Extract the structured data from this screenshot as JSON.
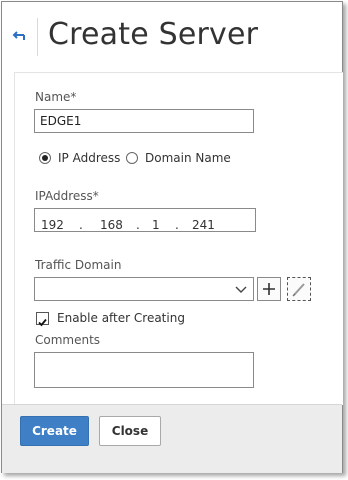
{
  "header": {
    "title": "Create Server"
  },
  "form": {
    "name_label": "Name*",
    "name_value": "EDGE1",
    "radio_ip_label": "IP Address",
    "radio_domain_label": "Domain Name",
    "ip_label": "IPAddress*",
    "ip_octets": [
      "192",
      "168",
      "1",
      "241"
    ],
    "ip_separator": ".",
    "traffic_domain_label": "Traffic Domain",
    "traffic_domain_value": "",
    "enable_label": "Enable after Creating",
    "comments_label": "Comments",
    "comments_value": ""
  },
  "footer": {
    "create_label": "Create",
    "close_label": "Close"
  },
  "colors": {
    "primary": "#3f7fc6",
    "back_arrow": "#2d6fc1"
  },
  "icons": [
    "back-arrow-icon",
    "chevron-down-icon",
    "plus-icon",
    "pencil-icon",
    "checkmark-icon"
  ]
}
